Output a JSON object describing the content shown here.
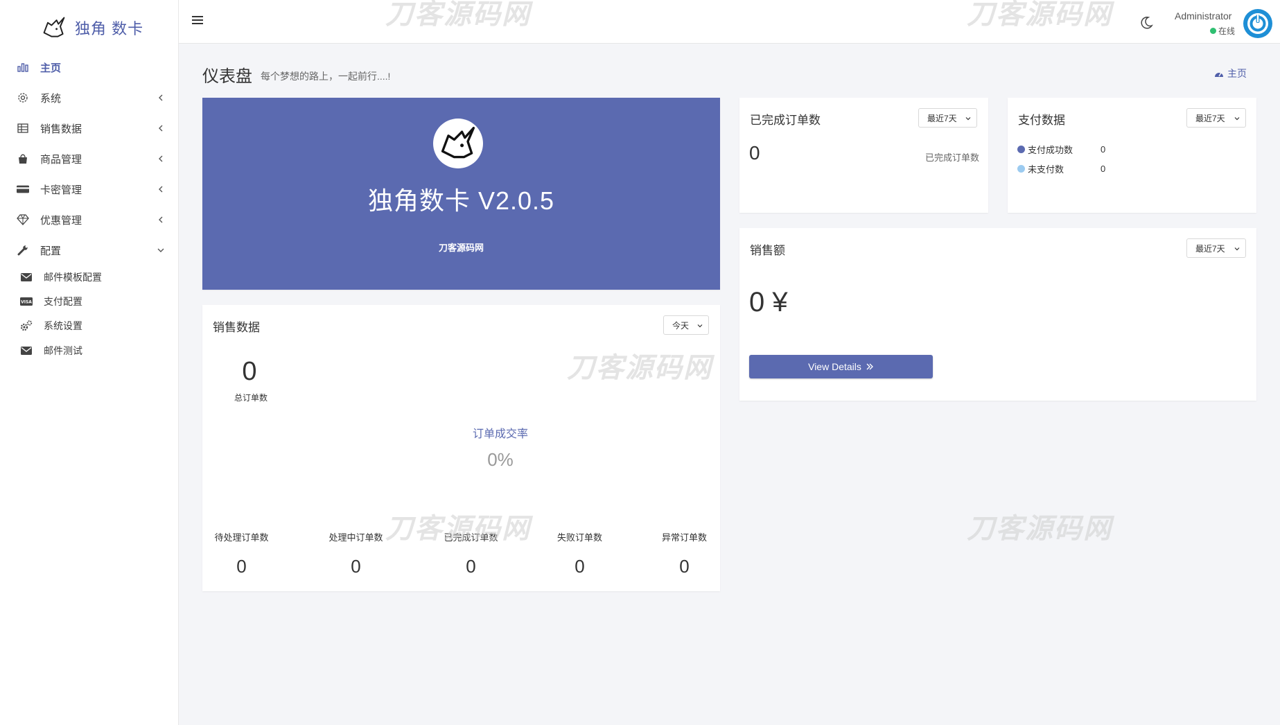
{
  "brand": {
    "name": "独角 数卡"
  },
  "sidebar": {
    "items": [
      {
        "label": "主页",
        "icon": "bar-chart-icon",
        "active": true
      },
      {
        "label": "系统",
        "icon": "gear-icon"
      },
      {
        "label": "销售数据",
        "icon": "table-icon"
      },
      {
        "label": "商品管理",
        "icon": "shopping-bag-icon"
      },
      {
        "label": "卡密管理",
        "icon": "credit-card-icon"
      },
      {
        "label": "优惠管理",
        "icon": "diamond-icon"
      },
      {
        "label": "配置",
        "icon": "wrench-icon",
        "expanded": true
      }
    ],
    "subitems": [
      {
        "label": "邮件模板配置",
        "icon": "envelope-icon"
      },
      {
        "label": "支付配置",
        "icon": "visa-card-icon"
      },
      {
        "label": "系统设置",
        "icon": "cogs-icon"
      },
      {
        "label": "邮件测试",
        "icon": "envelope-icon"
      }
    ]
  },
  "header": {
    "user_name": "Administrator",
    "user_status": "在线"
  },
  "page": {
    "title": "仪表盘",
    "subtitle": "每个梦想的路上，一起前行....!",
    "breadcrumb": "主页"
  },
  "hero": {
    "title": "独角数卡 V2.0.5",
    "subtitle": "刀客源码网"
  },
  "sales_data": {
    "title": "销售数据",
    "range": "今天",
    "total_orders": "0",
    "total_orders_label": "总订单数",
    "conversion_label": "订单成交率",
    "conversion_value": "0%",
    "stats": [
      {
        "label": "待处理订单数",
        "value": "0"
      },
      {
        "label": "处理中订单数",
        "value": "0"
      },
      {
        "label": "已完成订单数",
        "value": "0"
      },
      {
        "label": "失败订单数",
        "value": "0"
      },
      {
        "label": "异常订单数",
        "value": "0"
      }
    ]
  },
  "completed_orders": {
    "title": "已完成订单数",
    "range": "最近7天",
    "value": "0",
    "label": "已完成订单数"
  },
  "payment_data": {
    "title": "支付数据",
    "range": "最近7天",
    "legend": [
      {
        "label": "支付成功数",
        "value": "0",
        "color": "#5b6ab0"
      },
      {
        "label": "未支付数",
        "value": "0",
        "color": "#9ccbf0"
      }
    ]
  },
  "sales_amount": {
    "title": "销售额",
    "range": "最近7天",
    "value": "0 ¥",
    "button": "View Details"
  },
  "watermark": "刀客源码网",
  "colors": {
    "primary": "#5b6ab0",
    "online": "#2fbf71",
    "background": "#f4f5f8"
  }
}
